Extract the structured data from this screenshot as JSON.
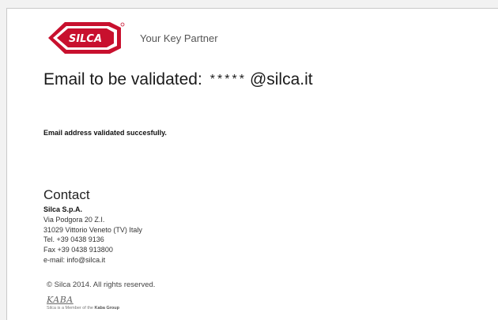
{
  "header": {
    "logo_text": "SILCA",
    "tagline": "Your Key Partner"
  },
  "validation": {
    "label": "Email to be validated:",
    "masked": "*****",
    "domain": "@silca.it",
    "status": "Email address validated succesfully."
  },
  "contact": {
    "title": "Contact",
    "company": "Silca S.p.A.",
    "address": "Via Podgora 20 Z.I.",
    "city": "31029 Vittorio Veneto (TV) Italy",
    "tel": "Tel. +39 0438 9136",
    "fax": "Fax +39 0438 913800",
    "email": "e-mail: info@silca.it"
  },
  "footer": {
    "copyright": "© Silca 2014. All rights reserved.",
    "kaba_logo": "KABA",
    "member_prefix": "Silca is a Member of the",
    "member_group": "Kaba Group"
  },
  "colors": {
    "brand_red": "#c8102e"
  }
}
